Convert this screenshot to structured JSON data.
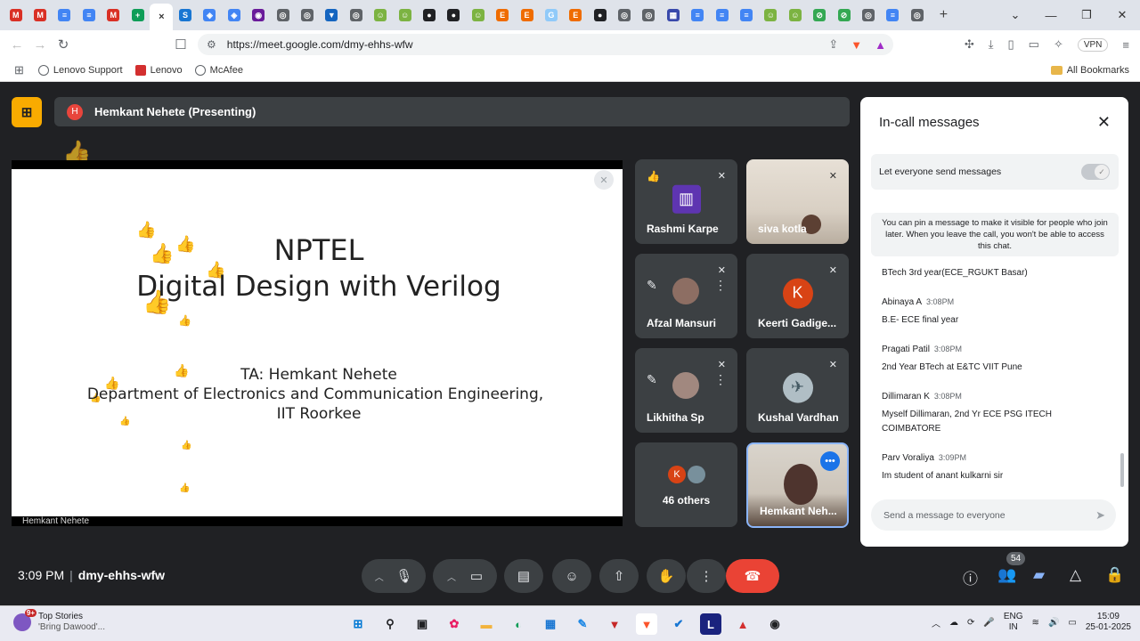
{
  "browser": {
    "tab_favicons": [
      {
        "label": "M",
        "color": "#d93025"
      },
      {
        "label": "M",
        "color": "#d93025"
      },
      {
        "label": "≡",
        "color": "#4285f4"
      },
      {
        "label": "≡",
        "color": "#4285f4"
      },
      {
        "label": "M",
        "color": "#d93025"
      },
      {
        "label": "+",
        "color": "#0f9d58"
      },
      {
        "label": "×",
        "color": "#ffffff",
        "active": true
      },
      {
        "label": "S",
        "color": "#1976d2"
      },
      {
        "label": "◈",
        "color": "#4285f4"
      },
      {
        "label": "◈",
        "color": "#4285f4"
      },
      {
        "label": "◉",
        "color": "#6a1b9a"
      },
      {
        "label": "◎",
        "color": "#5f6368"
      },
      {
        "label": "◎",
        "color": "#5f6368"
      },
      {
        "label": "▼",
        "color": "#1565c0"
      },
      {
        "label": "◎",
        "color": "#5f6368"
      },
      {
        "label": "☺",
        "color": "#7cb342"
      },
      {
        "label": "☺",
        "color": "#7cb342"
      },
      {
        "label": "●",
        "color": "#202124"
      },
      {
        "label": "●",
        "color": "#202124"
      },
      {
        "label": "☺",
        "color": "#7cb342"
      },
      {
        "label": "E",
        "color": "#ef6c00"
      },
      {
        "label": "E",
        "color": "#ef6c00"
      },
      {
        "label": "G",
        "color": "#90caf9"
      },
      {
        "label": "E",
        "color": "#ef6c00"
      },
      {
        "label": "●",
        "color": "#202124"
      },
      {
        "label": "◎",
        "color": "#5f6368"
      },
      {
        "label": "◎",
        "color": "#5f6368"
      },
      {
        "label": "▦",
        "color": "#3949ab"
      },
      {
        "label": "≡",
        "color": "#4285f4"
      },
      {
        "label": "≡",
        "color": "#4285f4"
      },
      {
        "label": "≡",
        "color": "#4285f4"
      },
      {
        "label": "☺",
        "color": "#7cb342"
      },
      {
        "label": "☺",
        "color": "#7cb342"
      },
      {
        "label": "⊘",
        "color": "#34a853"
      },
      {
        "label": "⊘",
        "color": "#34a853"
      },
      {
        "label": "◎",
        "color": "#5f6368"
      },
      {
        "label": "≡",
        "color": "#4285f4"
      },
      {
        "label": "◎",
        "color": "#5f6368"
      }
    ],
    "url": "https://meet.google.com/dmy-ehhs-wfw",
    "vpn_label": "VPN",
    "bookmarks": [
      {
        "label": "Lenovo Support",
        "color": "#5f6368"
      },
      {
        "label": "Lenovo",
        "color": "#d32f2f"
      },
      {
        "label": "McAfee",
        "color": "#5f6368"
      }
    ],
    "all_bookmarks": "All Bookmarks"
  },
  "meet": {
    "presenter_initial": "H",
    "presenter_label": "Hemkant Nehete (Presenting)",
    "slide": {
      "title_line1": "NPTEL",
      "title_line2": "Digital Design with Verilog",
      "ta_line": "TA: Hemkant Nehete",
      "dept_line": "Department of Electronics and Communication Engineering,",
      "inst_line": "IIT Roorkee",
      "footer": "Hemkant Nehete"
    },
    "participants": [
      {
        "name": "Rashmi Karpe"
      },
      {
        "name": "siva kotla"
      },
      {
        "name": "Afzal Mansuri"
      },
      {
        "name": "Keerti Gadige...",
        "initial": "K"
      },
      {
        "name": "Likhitha Sp"
      },
      {
        "name": "Kushal Vardhan"
      },
      {
        "name": "46 others",
        "initial": "K"
      },
      {
        "name": "Hemkant Neh..."
      }
    ],
    "time": "3:09 PM",
    "meeting_code": "dmy-ehhs-wfw",
    "people_count": "54"
  },
  "chat": {
    "title": "In-call messages",
    "toggle_label": "Let everyone send messages",
    "pin_note": "You can pin a message to make it visible for people who join later. When you leave the call, you won't be able to access this chat.",
    "first_msg": "BTech 3rd year(ECE_RGUKT Basar)",
    "messages": [
      {
        "sender": "Abinaya A",
        "time": "3:08PM",
        "text": "B.E- ECE  final year"
      },
      {
        "sender": "Pragati Patil",
        "time": "3:08PM",
        "text": "2nd Year BTech at E&TC VIIT Pune"
      },
      {
        "sender": "Dillimaran K",
        "time": "3:08PM",
        "text": "Myself Dillimaran, 2nd Yr ECE PSG ITECH COIMBATORE"
      },
      {
        "sender": "Parv Voraliya",
        "time": "3:09PM",
        "text": "Im student of anant kulkarni sir"
      }
    ],
    "input_placeholder": "Send a message to everyone"
  },
  "taskbar": {
    "news_title": "Top Stories",
    "news_sub": "'Bring Dawood'...",
    "news_badge": "9+",
    "lang": "ENG",
    "region": "IN",
    "clock_time": "15:09",
    "clock_date": "25-01-2025",
    "app_labels": [
      "L"
    ]
  }
}
